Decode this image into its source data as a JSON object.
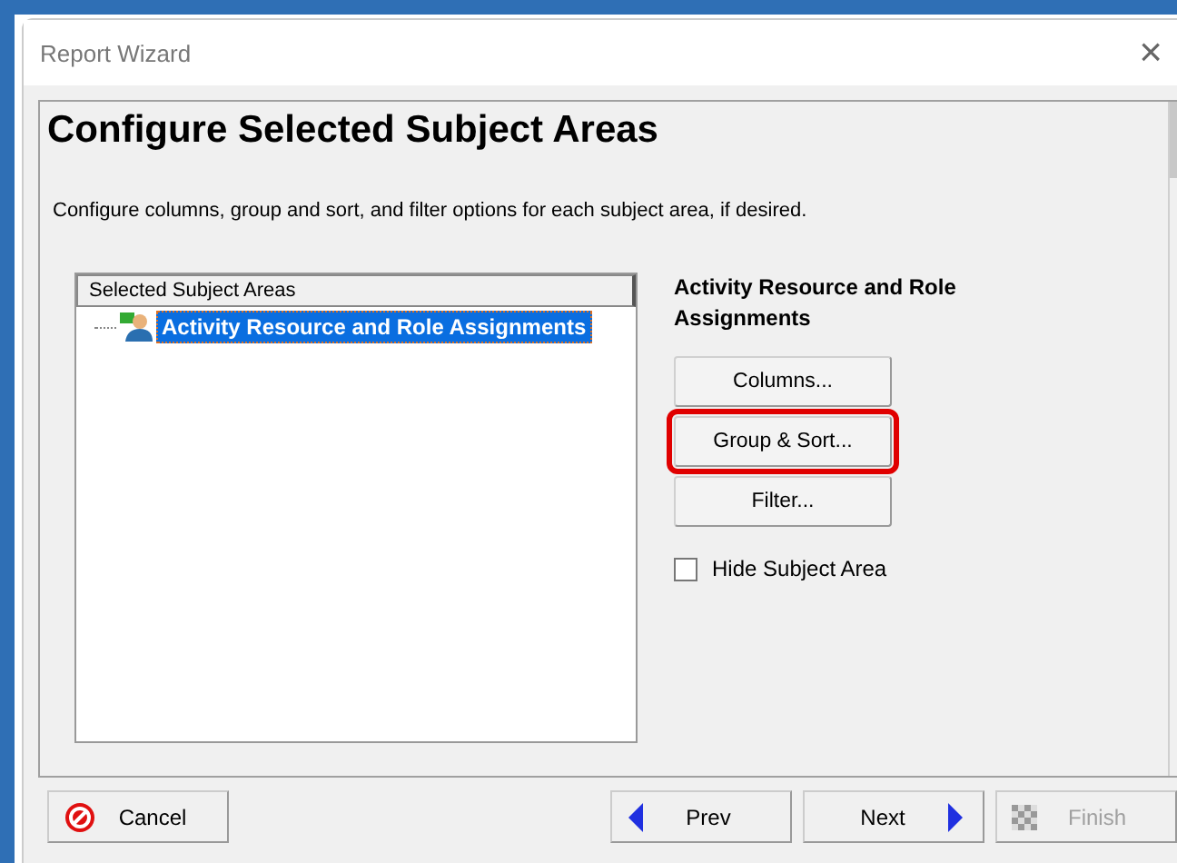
{
  "window": {
    "title": "Report Wizard",
    "close": "×"
  },
  "page": {
    "heading": "Configure Selected Subject Areas",
    "description": "Configure columns, group and sort, and filter options for each subject area, if desired."
  },
  "subject_list": {
    "header": "Selected Subject Areas",
    "items": [
      {
        "label": "Activity Resource and Role Assignments",
        "selected": true
      }
    ]
  },
  "options": {
    "title": "Activity Resource and Role Assignments",
    "buttons": [
      {
        "label": "Columns...",
        "highlighted": false
      },
      {
        "label": "Group & Sort...",
        "highlighted": true
      },
      {
        "label": "Filter...",
        "highlighted": false
      }
    ],
    "hide_checkbox": {
      "label": "Hide Subject Area",
      "checked": false
    }
  },
  "footer": [
    {
      "kind": "cancel",
      "label": "Cancel",
      "disabled": false
    },
    {
      "kind": "prev",
      "label": "Prev",
      "disabled": false
    },
    {
      "kind": "next",
      "label": "Next",
      "disabled": false
    },
    {
      "kind": "finish",
      "label": "Finish",
      "disabled": true
    }
  ]
}
